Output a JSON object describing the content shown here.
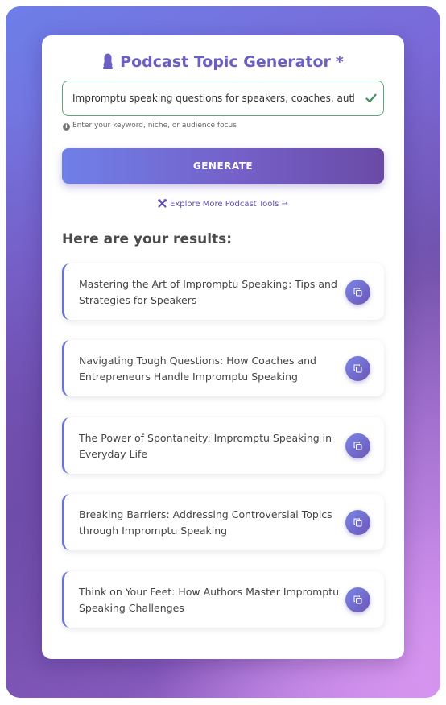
{
  "header": {
    "title": "Podcast Topic Generator",
    "required_mark": "*",
    "icon": "microphone-icon"
  },
  "input": {
    "value": "Impromptu speaking questions for speakers, coaches, authors, and entrepreneurs",
    "hint": "Enter your keyword, niche, or audience focus",
    "valid_icon": "checkmark-icon"
  },
  "generate_button": {
    "label": "GENERATE"
  },
  "explore_link": {
    "label": "Explore More Podcast Tools →",
    "icon": "tools-icon"
  },
  "results": {
    "heading": "Here are your results:",
    "items": [
      {
        "text": "Mastering the Art of Impromptu Speaking: Tips and Strategies for Speakers"
      },
      {
        "text": "Navigating Tough Questions: How Coaches and Entrepreneurs Handle Impromptu Speaking"
      },
      {
        "text": "The Power of Spontaneity: Impromptu Speaking in Everyday Life"
      },
      {
        "text": "Breaking Barriers: Addressing Controversial Topics through Impromptu Speaking"
      },
      {
        "text": "Think on Your Feet: How Authors Master Impromptu Speaking Challenges"
      }
    ]
  },
  "colors": {
    "accent": "#6b5fc4",
    "valid_border": "#5aa879",
    "heading_text": "#4a4a4a"
  }
}
